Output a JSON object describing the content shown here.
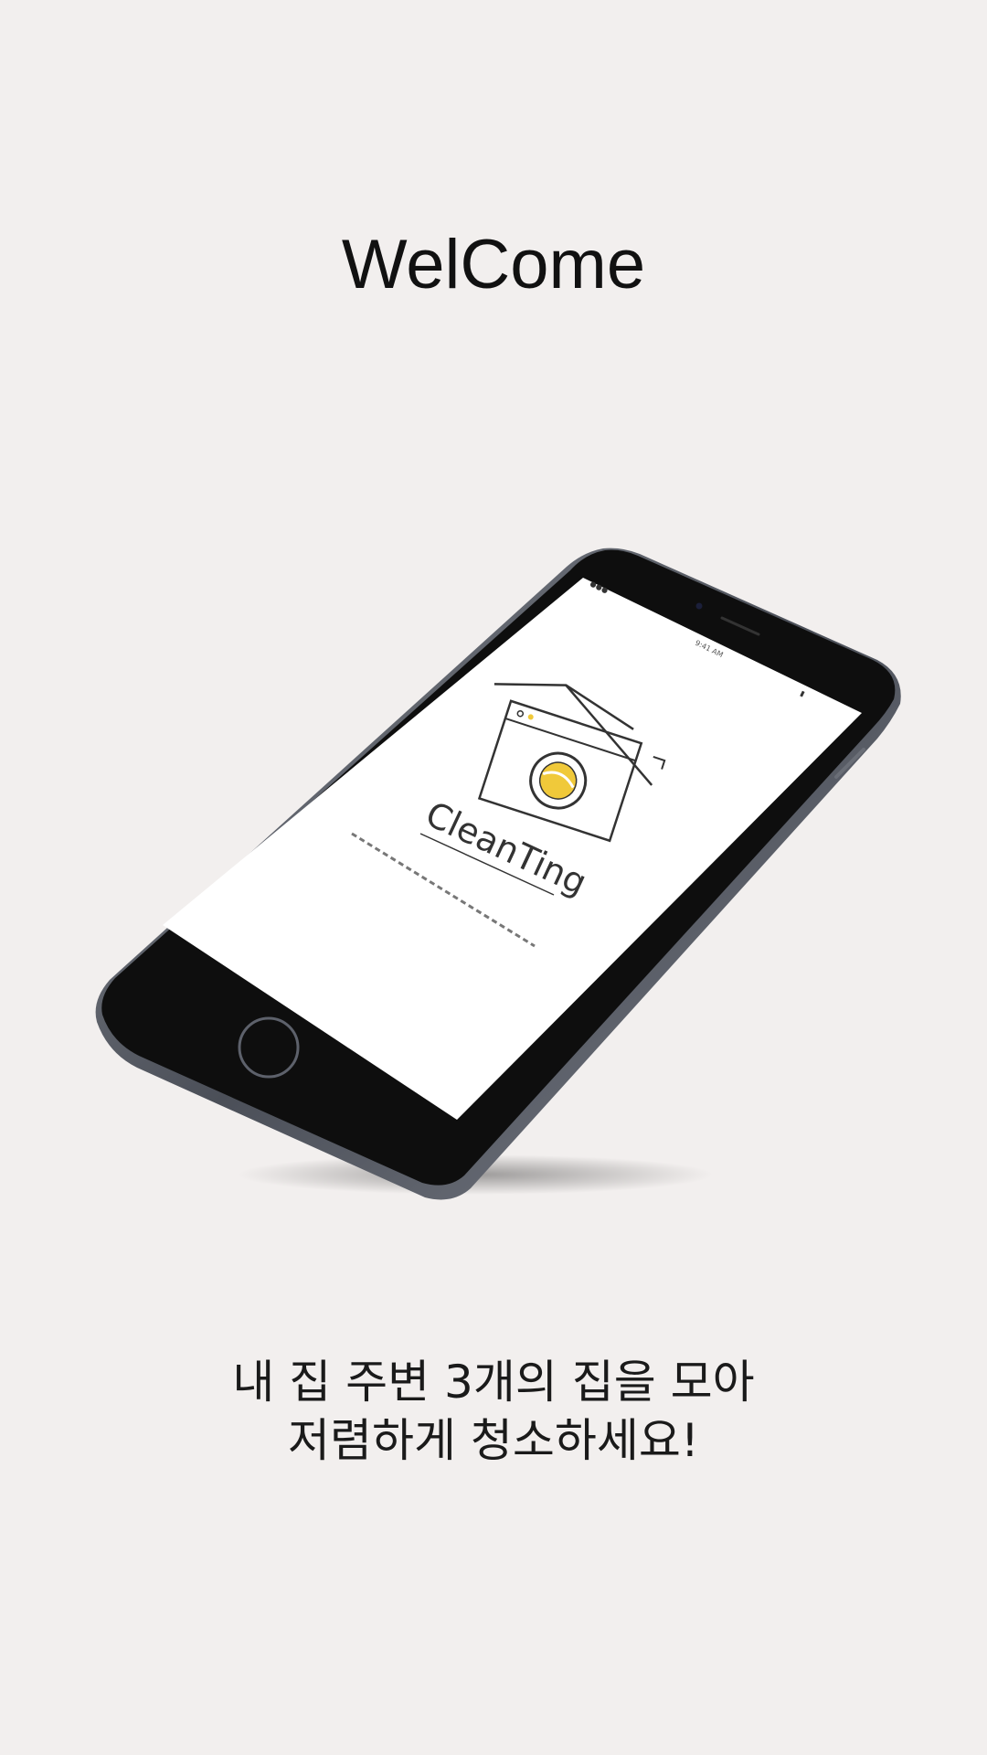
{
  "welcome": {
    "title": "WelCome"
  },
  "phone_screen": {
    "logo_text": "CleanTing"
  },
  "tagline": {
    "line1": "내 집 주변 3개의 집을 모아",
    "line2": "저렴하게 청소하세요!"
  },
  "colors": {
    "background": "#f2efee",
    "logo_accent": "#f0c93a",
    "phone_body": "#0e0e0e",
    "phone_frame": "#5b5f69"
  },
  "icons": {
    "logo": "house-washing-machine-icon"
  }
}
